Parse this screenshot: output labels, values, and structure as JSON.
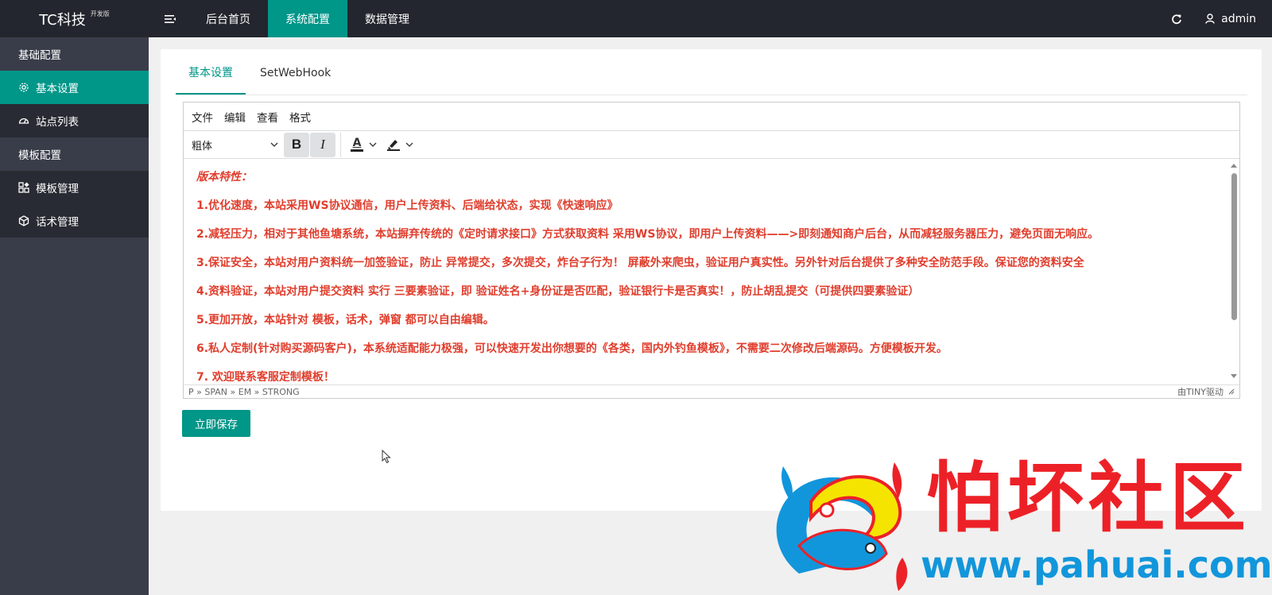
{
  "header": {
    "logo": "TC科技",
    "logo_badge": "开发版",
    "nav": [
      {
        "label": "后台首页",
        "active": false
      },
      {
        "label": "系统配置",
        "active": true
      },
      {
        "label": "数据管理",
        "active": false
      }
    ],
    "user": "admin"
  },
  "sidebar": {
    "group1": "基础配置",
    "item_basic": "基本设置",
    "item_sites": "站点列表",
    "group2": "模板配置",
    "item_template": "模板管理",
    "item_script": "话术管理"
  },
  "tabs": {
    "basic": "基本设置",
    "webhook": "SetWebHook"
  },
  "editor": {
    "menu": {
      "file": "文件",
      "edit": "编辑",
      "view": "查看",
      "format": "格式"
    },
    "font_select": "粗体",
    "bold": "B",
    "italic": "I",
    "text_color_letter": "A",
    "paragraphs": [
      "版本特性：",
      "1.优化速度，本站采用WS协议通信，用户上传资料、后端给状态，实现《快速响应》",
      "2.减轻压力，相对于其他鱼塘系统，本站摒弃传统的《定时请求接口》方式获取资料  采用WS协议，即用户上传资料——>即刻通知商户后台，从而减轻服务器压力，避免页面无响应。",
      "3.保证安全，本站对用户资料统一加签验证，防止 异常提交，多次提交，炸台子行为！  屏蔽外来爬虫，验证用户真实性。另外针对后台提供了多种安全防范手段。保证您的资料安全",
      "4.资料验证，本站对用户提交资料 实行 三要素验证，即 验证姓名+身份证是否匹配，验证银行卡是否真实！，防止胡乱提交（可提供四要素验证）",
      "5.更加开放，本站针对 模板，话术，弹窗 都可以自由编辑。",
      "6.私人定制(针对购买源码客户)，本系统适配能力极强，可以快速开发出你想要的《各类，国内外钓鱼模板》，不需要二次修改后端源码。方便模板开发。",
      "7. 欢迎联系客服定制模板！"
    ],
    "path": "P » SPAN » EM » STRONG",
    "powered": "由TINY驱动"
  },
  "save_button": "立即保存",
  "watermark": {
    "title": "怕坏社区",
    "url": "www.pahuai.com"
  },
  "colors": {
    "accent": "#009688",
    "header_bg": "#23262e",
    "sidebar_bg": "#393d49",
    "text_red": "#e03e2d"
  }
}
